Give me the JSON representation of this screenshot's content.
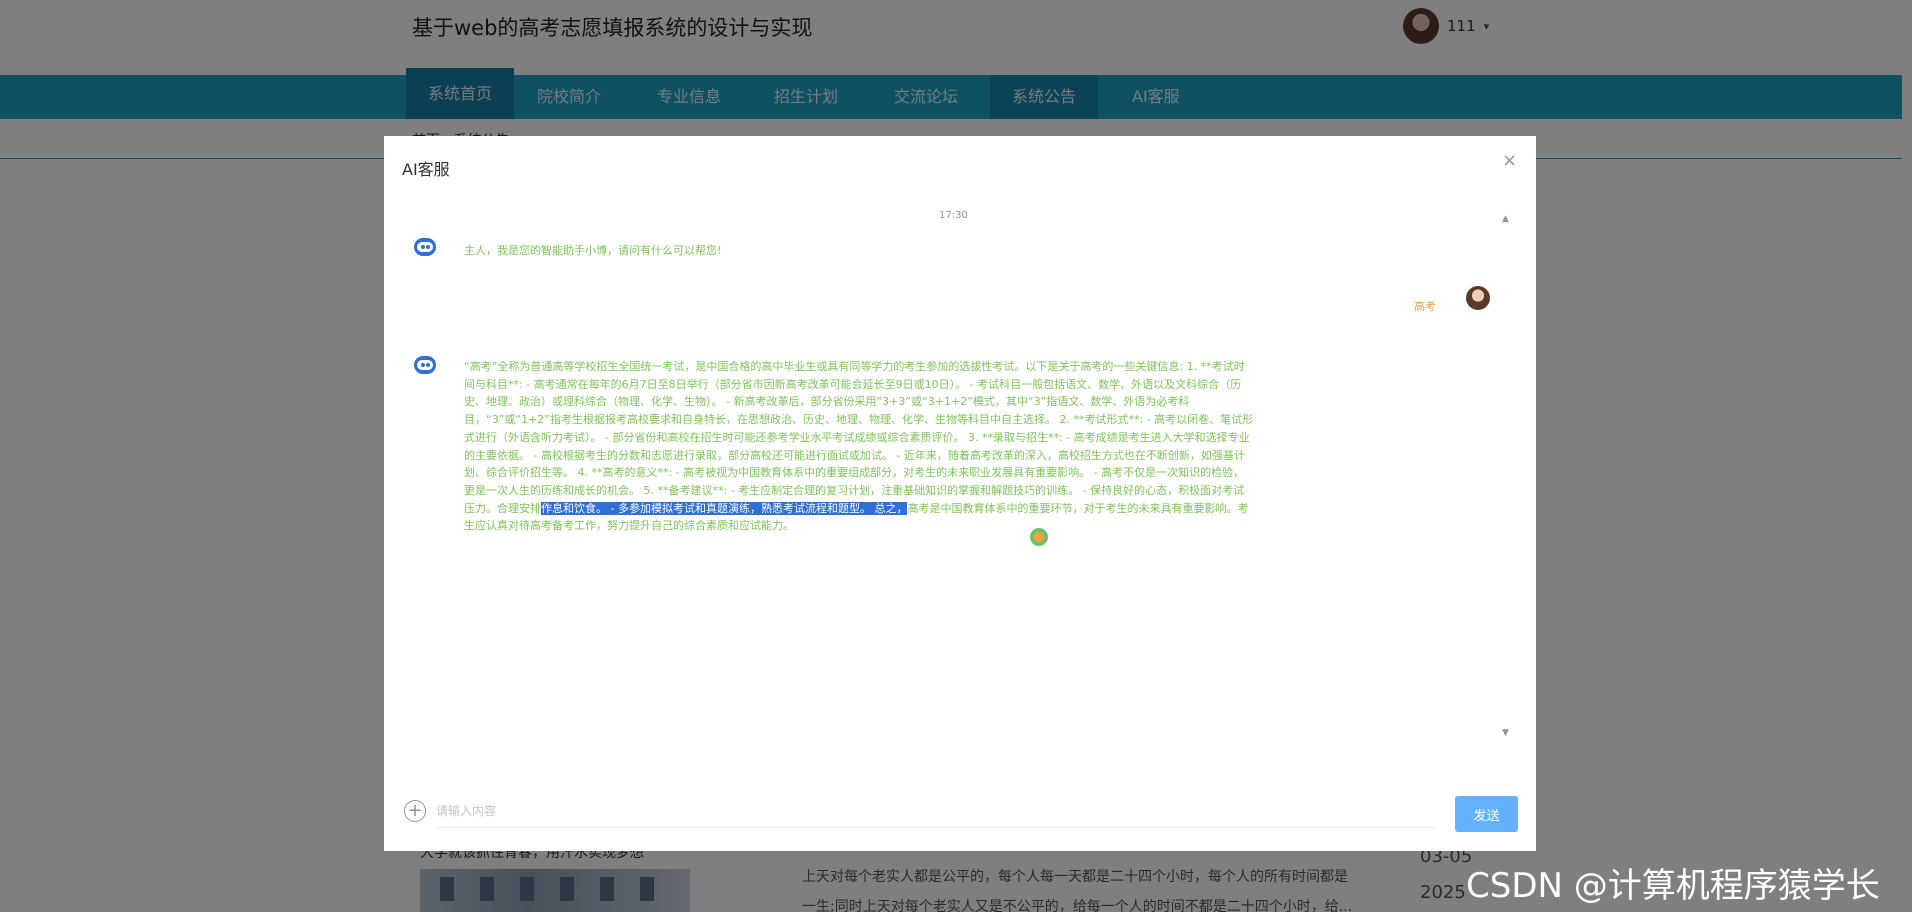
{
  "site": {
    "title": "基于web的高考志愿填报系统的设计与实现",
    "user_name": "111",
    "user_caret": "▾",
    "nav": [
      "系统首页",
      "院校简介",
      "专业信息",
      "招生计划",
      "交流论坛",
      "系统公告",
      "AI客服"
    ],
    "breadcrumb": "首页 · 系统公告"
  },
  "news": {
    "title": "大学就该抓住青春，用汗水实现梦想",
    "text_lines": [
      "上天对每个老实人都是公平的，每个人每一天都是二十四个小时，每个人的所有时间都是",
      "一生;同时上天对每个老实人又是不公平的，给每一个人的时间不都是二十四个小时，给..."
    ],
    "date": "03-05",
    "year": "2025"
  },
  "watermark": "CSDN @计算机程序猿学长",
  "dialog": {
    "title": "AI客服",
    "close": "×",
    "time": "17:30",
    "greeting": "主人，我是您的智能助手小博，请问有什么可以帮您!",
    "user_question": "高考",
    "answer_before": "“高考”全称为普通高等学校招生全国统一考试，是中国合格的高中毕业生或具有同等学力的考生参加的选拔性考试。以下是关于高考的一些关键信息: 1. **考试时间与科目**: - 高考通常在每年的6月7日至8日举行（部分省市因新高考改革可能会延长至9日或10日）。 - 考试科目一般包括语文、数学、外语以及文科综合（历史、地理、政治）或理科综合（物理、化学、生物）。 - 新高考改革后，部分省份采用“3+3”或“3+1+2”模式，其中“3”指语文、数学、外语为必考科目，“3”或“1+2”指考生根据报考高校要求和自身特长，在思想政治、历史、地理、物理、化学、生物等科目中自主选择。 2. **考试形式**: - 高考以闭卷、笔试形式进行（外语含听力考试）。 - 部分省份和高校在招生时可能还参考学业水平考试成绩或综合素质评价。 3. **录取与招生**: - 高考成绩是考生进入大学和选择专业的主要依据。 - 高校根据考生的分数和志愿进行录取，部分高校还可能进行面试或加试。 - 近年来，随着高考改革的深入，高校招生方式也在不断创新，如强基计划、综合评价招生等。 4. **高考的意义**: - 高考被视为中国教育体系中的重要组成部分，对考生的未来职业发展具有重要影响。 - 高考不仅是一次知识的检验，更是一次人生的历练和成长的机会。 5. **备考建议**: - 考生应制定合理的复习计划，注重基础知识的掌握和解题技巧的训练。 - 保持良好的心态，积极面对考试压力。合理安排",
    "answer_highlight": "作息和饮食。 - 多参加模拟考试和真题演练，熟悉考试流程和题型。 总之，",
    "answer_after": "高考是中国教育体系中的重要环节，对于考生的未来具有重要影响。考生应认真对待高考备考工作，努力提升自己的综合素质和应试能力。",
    "input_placeholder": "请输入内容",
    "send_label": "发送",
    "plus": "+",
    "scroll_up": "▲",
    "scroll_down": "▼"
  },
  "colors": {
    "nav": "#1aa3c7",
    "bot_text": "#7ec35a",
    "user_text": "#e6a23c",
    "send_button": "#66b1ff",
    "highlight": "#2f6fd6"
  },
  "icons": [
    "user-avatar-icon",
    "caret-down-icon",
    "close-icon",
    "robot-icon",
    "user-avatar-icon",
    "plus-circle-icon",
    "scroll-up-icon",
    "scroll-down-icon"
  ]
}
